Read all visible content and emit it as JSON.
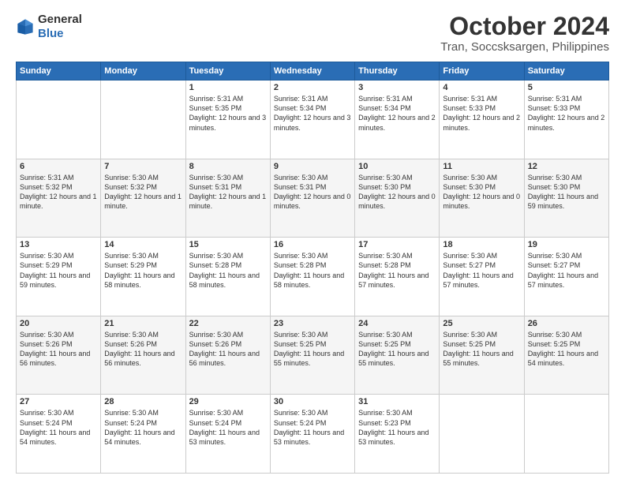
{
  "logo": {
    "general": "General",
    "blue": "Blue"
  },
  "header": {
    "month": "October 2024",
    "location": "Tran, Soccsksargen, Philippines"
  },
  "weekdays": [
    "Sunday",
    "Monday",
    "Tuesday",
    "Wednesday",
    "Thursday",
    "Friday",
    "Saturday"
  ],
  "rows": [
    [
      {
        "day": "",
        "content": ""
      },
      {
        "day": "",
        "content": ""
      },
      {
        "day": "1",
        "content": "Sunrise: 5:31 AM\nSunset: 5:35 PM\nDaylight: 12 hours\nand 3 minutes."
      },
      {
        "day": "2",
        "content": "Sunrise: 5:31 AM\nSunset: 5:34 PM\nDaylight: 12 hours\nand 3 minutes."
      },
      {
        "day": "3",
        "content": "Sunrise: 5:31 AM\nSunset: 5:34 PM\nDaylight: 12 hours\nand 2 minutes."
      },
      {
        "day": "4",
        "content": "Sunrise: 5:31 AM\nSunset: 5:33 PM\nDaylight: 12 hours\nand 2 minutes."
      },
      {
        "day": "5",
        "content": "Sunrise: 5:31 AM\nSunset: 5:33 PM\nDaylight: 12 hours\nand 2 minutes."
      }
    ],
    [
      {
        "day": "6",
        "content": "Sunrise: 5:31 AM\nSunset: 5:32 PM\nDaylight: 12 hours\nand 1 minute."
      },
      {
        "day": "7",
        "content": "Sunrise: 5:30 AM\nSunset: 5:32 PM\nDaylight: 12 hours\nand 1 minute."
      },
      {
        "day": "8",
        "content": "Sunrise: 5:30 AM\nSunset: 5:31 PM\nDaylight: 12 hours\nand 1 minute."
      },
      {
        "day": "9",
        "content": "Sunrise: 5:30 AM\nSunset: 5:31 PM\nDaylight: 12 hours\nand 0 minutes."
      },
      {
        "day": "10",
        "content": "Sunrise: 5:30 AM\nSunset: 5:30 PM\nDaylight: 12 hours\nand 0 minutes."
      },
      {
        "day": "11",
        "content": "Sunrise: 5:30 AM\nSunset: 5:30 PM\nDaylight: 12 hours\nand 0 minutes."
      },
      {
        "day": "12",
        "content": "Sunrise: 5:30 AM\nSunset: 5:30 PM\nDaylight: 11 hours\nand 59 minutes."
      }
    ],
    [
      {
        "day": "13",
        "content": "Sunrise: 5:30 AM\nSunset: 5:29 PM\nDaylight: 11 hours\nand 59 minutes."
      },
      {
        "day": "14",
        "content": "Sunrise: 5:30 AM\nSunset: 5:29 PM\nDaylight: 11 hours\nand 58 minutes."
      },
      {
        "day": "15",
        "content": "Sunrise: 5:30 AM\nSunset: 5:28 PM\nDaylight: 11 hours\nand 58 minutes."
      },
      {
        "day": "16",
        "content": "Sunrise: 5:30 AM\nSunset: 5:28 PM\nDaylight: 11 hours\nand 58 minutes."
      },
      {
        "day": "17",
        "content": "Sunrise: 5:30 AM\nSunset: 5:28 PM\nDaylight: 11 hours\nand 57 minutes."
      },
      {
        "day": "18",
        "content": "Sunrise: 5:30 AM\nSunset: 5:27 PM\nDaylight: 11 hours\nand 57 minutes."
      },
      {
        "day": "19",
        "content": "Sunrise: 5:30 AM\nSunset: 5:27 PM\nDaylight: 11 hours\nand 57 minutes."
      }
    ],
    [
      {
        "day": "20",
        "content": "Sunrise: 5:30 AM\nSunset: 5:26 PM\nDaylight: 11 hours\nand 56 minutes."
      },
      {
        "day": "21",
        "content": "Sunrise: 5:30 AM\nSunset: 5:26 PM\nDaylight: 11 hours\nand 56 minutes."
      },
      {
        "day": "22",
        "content": "Sunrise: 5:30 AM\nSunset: 5:26 PM\nDaylight: 11 hours\nand 56 minutes."
      },
      {
        "day": "23",
        "content": "Sunrise: 5:30 AM\nSunset: 5:25 PM\nDaylight: 11 hours\nand 55 minutes."
      },
      {
        "day": "24",
        "content": "Sunrise: 5:30 AM\nSunset: 5:25 PM\nDaylight: 11 hours\nand 55 minutes."
      },
      {
        "day": "25",
        "content": "Sunrise: 5:30 AM\nSunset: 5:25 PM\nDaylight: 11 hours\nand 55 minutes."
      },
      {
        "day": "26",
        "content": "Sunrise: 5:30 AM\nSunset: 5:25 PM\nDaylight: 11 hours\nand 54 minutes."
      }
    ],
    [
      {
        "day": "27",
        "content": "Sunrise: 5:30 AM\nSunset: 5:24 PM\nDaylight: 11 hours\nand 54 minutes."
      },
      {
        "day": "28",
        "content": "Sunrise: 5:30 AM\nSunset: 5:24 PM\nDaylight: 11 hours\nand 54 minutes."
      },
      {
        "day": "29",
        "content": "Sunrise: 5:30 AM\nSunset: 5:24 PM\nDaylight: 11 hours\nand 53 minutes."
      },
      {
        "day": "30",
        "content": "Sunrise: 5:30 AM\nSunset: 5:24 PM\nDaylight: 11 hours\nand 53 minutes."
      },
      {
        "day": "31",
        "content": "Sunrise: 5:30 AM\nSunset: 5:23 PM\nDaylight: 11 hours\nand 53 minutes."
      },
      {
        "day": "",
        "content": ""
      },
      {
        "day": "",
        "content": ""
      }
    ]
  ]
}
